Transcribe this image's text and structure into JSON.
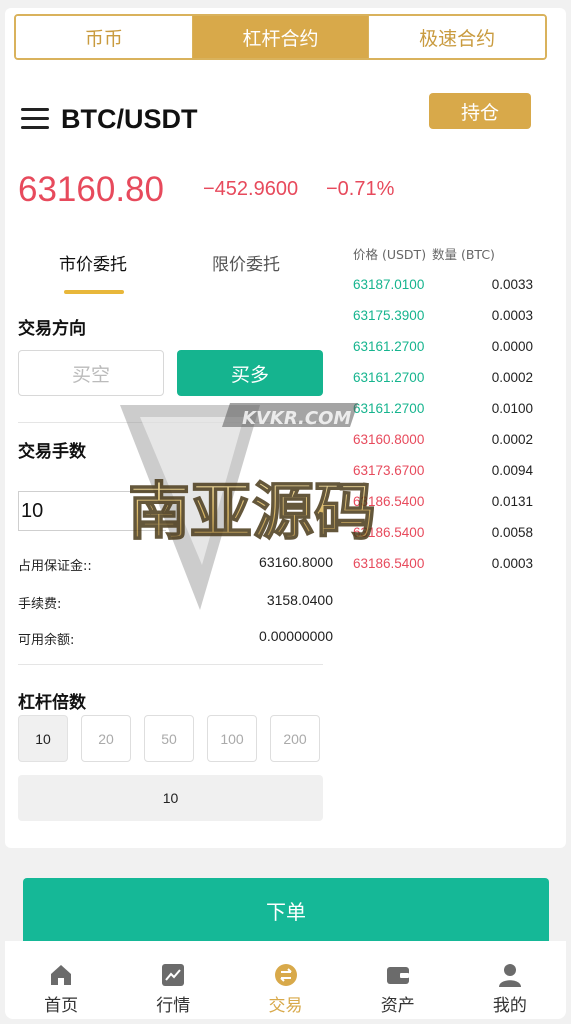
{
  "top_tabs": [
    {
      "label": "币币",
      "active": false
    },
    {
      "label": "杠杆合约",
      "active": true
    },
    {
      "label": "极速合约",
      "active": false
    }
  ],
  "header": {
    "pair": "BTC/USDT",
    "position_button": "持仓",
    "menu_icon": "hamburger-menu-icon"
  },
  "price": {
    "last": "63160.80",
    "change": "−452.9600",
    "change_pct": "−0.71%"
  },
  "order_tabs": [
    {
      "label": "市价委托",
      "active": true
    },
    {
      "label": "限价委托",
      "active": false
    }
  ],
  "direction": {
    "title": "交易方向",
    "short_label": "买空",
    "long_label": "买多",
    "selected": "long"
  },
  "quantity": {
    "title": "交易手数",
    "value": "10"
  },
  "info": [
    {
      "label": "占用保证金::",
      "value": "63160.8000"
    },
    {
      "label": "手续费:",
      "value": "3158.0400"
    },
    {
      "label": "可用余额:",
      "value": "0.00000000"
    }
  ],
  "leverage": {
    "title": "杠杆倍数",
    "options": [
      "10",
      "20",
      "50",
      "100",
      "200"
    ],
    "selected": "10",
    "display": "10"
  },
  "order_book": {
    "header_price": "价格 (USDT)",
    "header_qty": "数量 (BTC)",
    "asks_color": "#16b48e",
    "bids_color": "#e74a5c",
    "rows": [
      {
        "price": "63187.0100",
        "qty": "0.0033",
        "side": "green"
      },
      {
        "price": "63175.3900",
        "qty": "0.0003",
        "side": "green"
      },
      {
        "price": "63161.2700",
        "qty": "0.0000",
        "side": "green"
      },
      {
        "price": "63161.2700",
        "qty": "0.0002",
        "side": "green"
      },
      {
        "price": "63161.2700",
        "qty": "0.0100",
        "side": "green"
      },
      {
        "price": "63160.8000",
        "qty": "0.0002",
        "side": "red"
      },
      {
        "price": "63173.6700",
        "qty": "0.0094",
        "side": "red"
      },
      {
        "price": "63186.5400",
        "qty": "0.0131",
        "side": "red"
      },
      {
        "price": "63186.5400",
        "qty": "0.0058",
        "side": "red"
      },
      {
        "price": "63186.5400",
        "qty": "0.0003",
        "side": "red"
      }
    ]
  },
  "watermark": {
    "site": "KVKR.COM",
    "text": "南亚源码"
  },
  "submit_label": "下单",
  "bottom_nav": [
    {
      "label": "首页",
      "icon": "home-icon",
      "active": false
    },
    {
      "label": "行情",
      "icon": "chart-icon",
      "active": false
    },
    {
      "label": "交易",
      "icon": "exchange-icon",
      "active": true
    },
    {
      "label": "资产",
      "icon": "wallet-icon",
      "active": false
    },
    {
      "label": "我的",
      "icon": "user-icon",
      "active": false
    }
  ],
  "colors": {
    "gold": "#d8a94a",
    "green": "#15b48f",
    "red": "#e74a5c"
  }
}
